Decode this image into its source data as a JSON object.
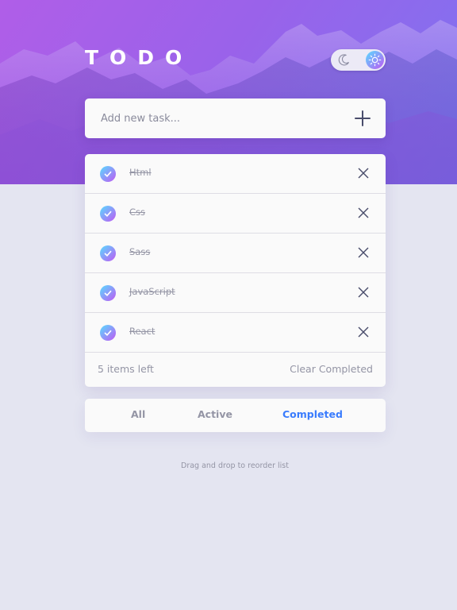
{
  "app": {
    "title": "TODO"
  },
  "theme_toggle": {
    "icons": [
      "moon-icon",
      "sun-icon"
    ],
    "selected": "light"
  },
  "new_task": {
    "placeholder": "Add new task...",
    "value": "",
    "add_icon": "plus-icon"
  },
  "todos": {
    "items": [
      {
        "label": "Html",
        "completed": true
      },
      {
        "label": "Css",
        "completed": true
      },
      {
        "label": "Sass",
        "completed": true
      },
      {
        "label": "JavaScript",
        "completed": true
      },
      {
        "label": "React",
        "completed": true
      }
    ],
    "items_left": "5 items left",
    "clear_label": "Clear Completed"
  },
  "filters": {
    "all": "All",
    "active": "Active",
    "completed": "Completed",
    "selected": "Completed"
  },
  "hint": "Drag and drop to reorder list",
  "colors": {
    "background": "#e4e5f1",
    "card": "#fafafa",
    "accent_blue": "#3a7cfd",
    "check_gradient_start": "#57ddff",
    "check_gradient_end": "#c058f3",
    "muted_text": "#9495a5"
  }
}
